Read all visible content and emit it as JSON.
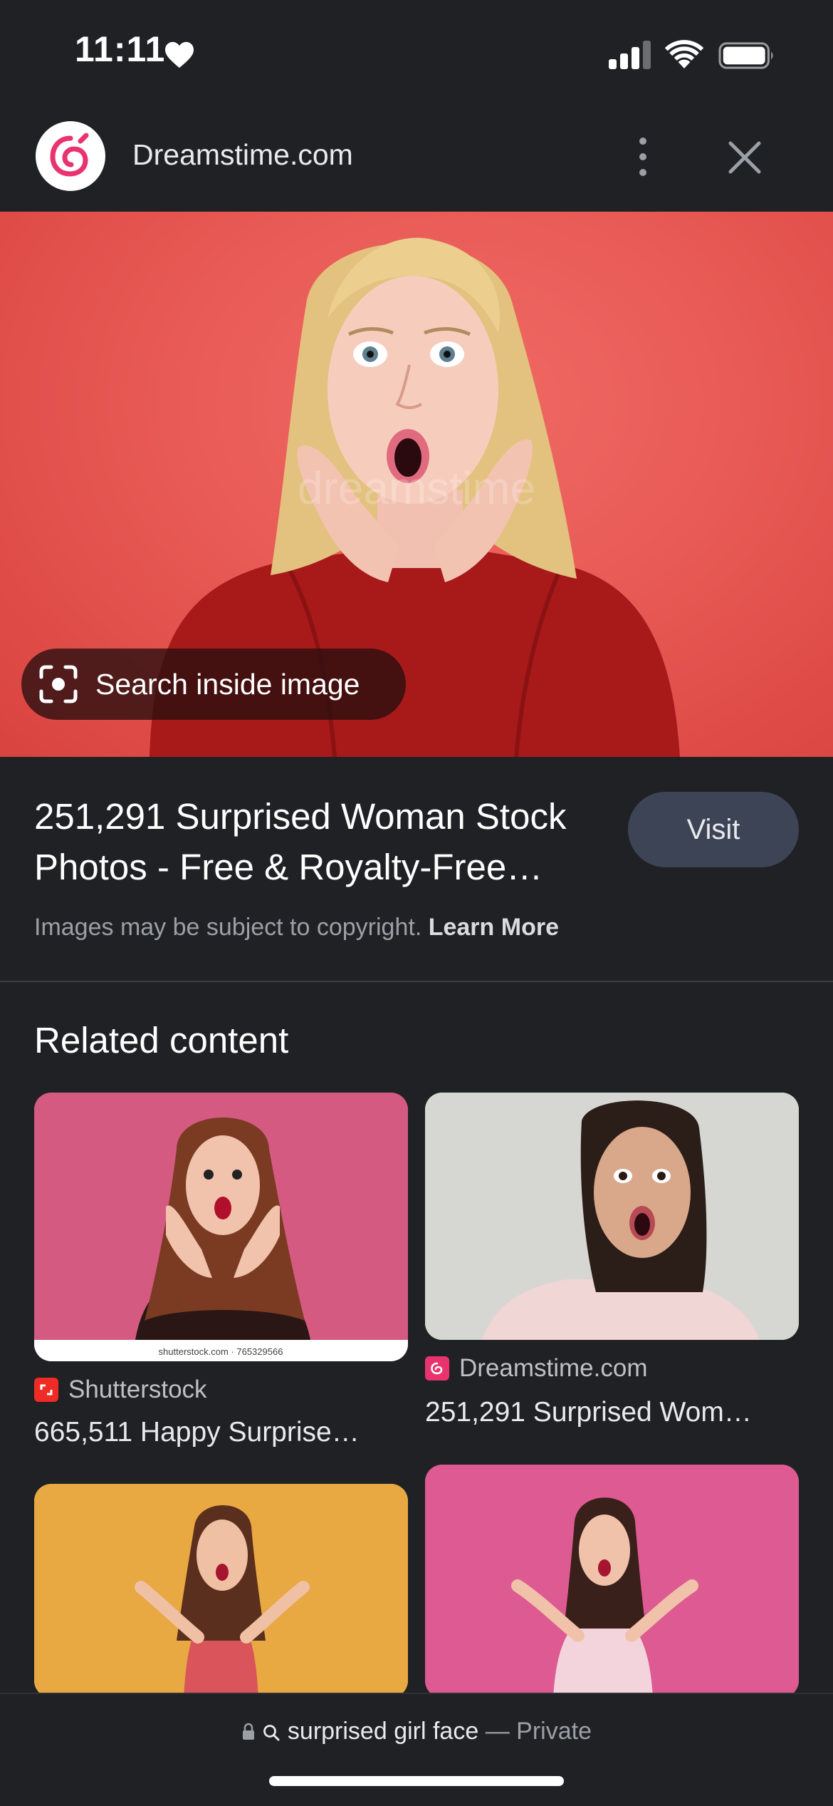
{
  "status_bar": {
    "time": "11:11"
  },
  "header": {
    "site_name": "Dreamstime.com"
  },
  "hero": {
    "search_inside_label": "Search inside image"
  },
  "result": {
    "title": "251,291 Surprised Woman Stock Photos - Free & Royalty-Free…",
    "visit_label": "Visit",
    "copyright_text": "Images may be subject to copyright.",
    "learn_more_label": "Learn More"
  },
  "related": {
    "heading": "Related content",
    "cards": [
      {
        "source": "Shutterstock",
        "title": "665,511 Happy Surprise…",
        "watermark": "shutterstock.com · 765329566"
      },
      {
        "source": "Dreamstime.com",
        "title": "251,291 Surprised Wom…"
      }
    ]
  },
  "bottom_bar": {
    "query": "surprised girl face",
    "separator": "—",
    "mode": "Private"
  },
  "colors": {
    "background": "#202124",
    "visit_button": "#3c4456",
    "dreamstime_brand": "#e8336f",
    "shutterstock_brand": "#ee2b24"
  }
}
